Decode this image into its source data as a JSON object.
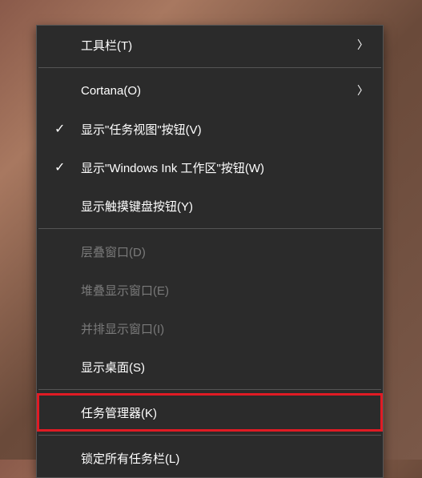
{
  "menu": {
    "toolbars": {
      "label": "工具栏(T)",
      "has_submenu": true
    },
    "cortana": {
      "label": "Cortana(O)",
      "has_submenu": true
    },
    "show_task_view": {
      "label": "显示\"任务视图\"按钮(V)",
      "checked": true
    },
    "show_windows_ink": {
      "label": "显示\"Windows Ink 工作区\"按钮(W)",
      "checked": true
    },
    "show_touch_keyboard": {
      "label": "显示触摸键盘按钮(Y)",
      "checked": false
    },
    "cascade_windows": {
      "label": "层叠窗口(D)",
      "disabled": true
    },
    "stacked_windows": {
      "label": "堆叠显示窗口(E)",
      "disabled": true
    },
    "side_by_side": {
      "label": "并排显示窗口(I)",
      "disabled": true
    },
    "show_desktop": {
      "label": "显示桌面(S)"
    },
    "task_manager": {
      "label": "任务管理器(K)",
      "highlighted": true
    },
    "lock_taskbar": {
      "label": "锁定所有任务栏(L)"
    }
  }
}
